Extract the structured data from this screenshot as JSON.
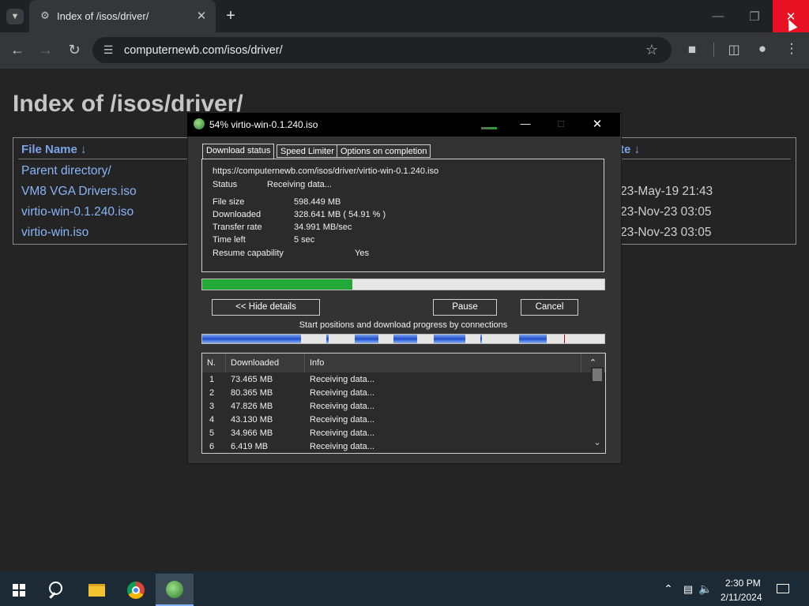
{
  "browser": {
    "tab_title": "Index of /isos/driver/",
    "new_tab": "+",
    "url": "computernewb.com/isos/driver/"
  },
  "page": {
    "heading": "Index of /isos/driver/",
    "col_name": "File Name  ↓",
    "col_date": "te  ↓",
    "files": [
      {
        "name": "Parent directory/",
        "date": ""
      },
      {
        "name": "VM8 VGA Drivers.iso",
        "date": "23-May-19 21:43"
      },
      {
        "name": "virtio-win-0.1.240.iso",
        "date": "23-Nov-23 03:05"
      },
      {
        "name": "virtio-win.iso",
        "date": "23-Nov-23 03:05"
      }
    ]
  },
  "dialog": {
    "title": "54% virtio-win-0.1.240.iso",
    "tabs": [
      "Download status",
      "Speed Limiter",
      "Options on completion"
    ],
    "url": "https://computernewb.com/isos/driver/virtio-win-0.1.240.iso",
    "status_label": "Status",
    "status_value": "Receiving data...",
    "file_size_label": "File size",
    "file_size_value": "598.449  MB",
    "downloaded_label": "Downloaded",
    "downloaded_value": "328.641  MB  ( 54.91 % )",
    "transfer_label": "Transfer rate",
    "transfer_value": "34.991  MB/sec",
    "time_left_label": "Time left",
    "time_left_value": "5 sec",
    "resume_label": "Resume capability",
    "resume_value": "Yes",
    "progress_fraction": 0.5491,
    "hide_details": "<< Hide details",
    "pause": "Pause",
    "cancel": "Cancel",
    "connections_caption": "Start positions and download progress by connections",
    "table_headers": [
      "N.",
      "Downloaded",
      "Info"
    ],
    "connections": [
      {
        "n": "1",
        "downloaded": "73.465  MB",
        "info": "Receiving data..."
      },
      {
        "n": "2",
        "downloaded": "80.365  MB",
        "info": "Receiving data..."
      },
      {
        "n": "3",
        "downloaded": "47.826  MB",
        "info": "Receiving data..."
      },
      {
        "n": "4",
        "downloaded": "43.130  MB",
        "info": "Receiving data..."
      },
      {
        "n": "5",
        "downloaded": "34.966  MB",
        "info": "Receiving data..."
      },
      {
        "n": "6",
        "downloaded": "6.419  MB",
        "info": "Receiving data..."
      }
    ]
  },
  "taskbar": {
    "time": "2:30 PM",
    "date": "2/11/2024"
  },
  "colors": {
    "progress_green": "#22a836",
    "close_red": "#e81123",
    "link_blue": "#8ab4f8"
  }
}
